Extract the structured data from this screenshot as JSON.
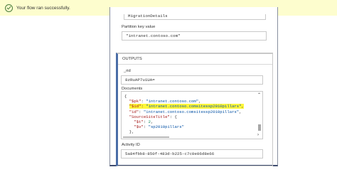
{
  "toast": {
    "message": "Your flow ran successfully."
  },
  "card": {
    "migration_value": "MigrationDetails",
    "partition_label": "Partition key value",
    "partition_value": "\"intranet.contoso.com\"",
    "outputs_label": "OUTPUTS",
    "rid_label": "_rid",
    "rid_value": "8zRuAP7u1UA=",
    "documents_label": "Documents",
    "documents_lines": [
      "{",
      "  \"$pk\": \"intranet.contoso.com\",",
      "  \"$id\": \"intranet.contoso.comsitessp2010pillars\",",
      "  \"id\": \"intranet.contoso.comsitessp2010pillars\",",
      "  \"SourceSiteTitle\": {",
      "    \"$t\": 2,",
      "    \"$v\": \"sp2010pillars\"",
      "  },"
    ],
    "activity_label": "Activity ID",
    "activity_value": "5a84fbb8-850f-483d-b225-c7c0e06d8e66"
  },
  "colors": {
    "toast_bg": "#fdfdce",
    "success": "#4a7d3c",
    "accent": "#4a6da7",
    "highlight": "#fff73a"
  }
}
